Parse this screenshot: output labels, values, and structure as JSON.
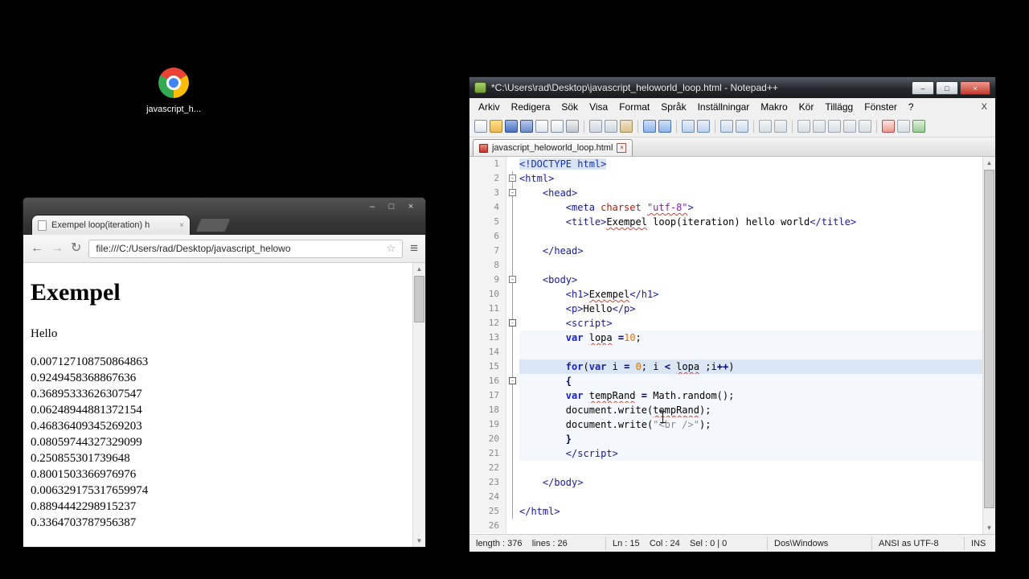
{
  "icons": {
    "minimize": "–",
    "maximize": "□",
    "close": "×",
    "back": "←",
    "forward": "→",
    "reload": "↻",
    "star": "☆",
    "menu": "≡",
    "up": "▲",
    "down": "▼",
    "fold_collapse": "-"
  },
  "desktop": {
    "icon_label": "javascript_h..."
  },
  "browser": {
    "tab_title": "Exempel loop(iteration) h",
    "url": "file:///C:/Users/rad/Desktop/javascript_helowo",
    "page": {
      "heading": "Exempel",
      "intro": "Hello",
      "numbers": [
        "0.007127108750864863",
        "0.9249458368867636",
        "0.36895333626307547",
        "0.06248944881372154",
        "0.46836409345269203",
        "0.08059744327329099",
        "0.250855301739648",
        "0.8001503366976976",
        "0.006329175317659974",
        "0.8894442298915237",
        "0.3364703787956387"
      ]
    }
  },
  "notepad": {
    "title": "*C:\\Users\\rad\\Desktop\\javascript_heloworld_loop.html - Notepad++",
    "menu": [
      "Arkiv",
      "Redigera",
      "Sök",
      "Visa",
      "Format",
      "Språk",
      "Inställningar",
      "Makro",
      "Kör",
      "Tillägg",
      "Fönster",
      "?"
    ],
    "menubar_close": "X",
    "toolbar_icons": [
      "new-file",
      "open",
      "save",
      "save-all",
      "close-doc",
      "close-all",
      "print",
      "|",
      "cut",
      "copy",
      "paste",
      "|",
      "undo",
      "redo",
      "|",
      "find",
      "replace",
      "|",
      "zoom-in",
      "zoom-out",
      "|",
      "sync-scroll-v",
      "sync-scroll-h",
      "|",
      "word-wrap",
      "show-all-chars",
      "indent-guide",
      "function-list",
      "doc-map",
      "|",
      "record-macro",
      "stop-macro",
      "play-macro"
    ],
    "tab": {
      "label": "javascript_heloworld_loop.html"
    },
    "editor": {
      "lines": [
        {
          "num": 1,
          "fold": "none",
          "band": false,
          "current": false,
          "segs": [
            [
              "doctype",
              "<!DOCTYPE html>"
            ]
          ]
        },
        {
          "num": 2,
          "fold": "box",
          "band": false,
          "current": false,
          "segs": [
            [
              "t",
              "<html>"
            ]
          ]
        },
        {
          "num": 3,
          "fold": "box",
          "band": false,
          "current": false,
          "segs": [
            [
              "pl",
              "    "
            ],
            [
              "t",
              "<head>"
            ]
          ]
        },
        {
          "num": 4,
          "fold": "line",
          "band": false,
          "current": false,
          "segs": [
            [
              "pl",
              "        "
            ],
            [
              "t",
              "<meta "
            ],
            [
              "attr",
              "charset "
            ],
            [
              "val",
              "\"utf-8\""
            ],
            [
              "t",
              ">"
            ]
          ]
        },
        {
          "num": 5,
          "fold": "line",
          "band": false,
          "current": false,
          "segs": [
            [
              "pl",
              "        "
            ],
            [
              "t",
              "<title>"
            ],
            [
              "sp",
              "Exempel"
            ],
            [
              "pl",
              " loop(iteration) hello world"
            ],
            [
              "t",
              "</title>"
            ]
          ]
        },
        {
          "num": 6,
          "fold": "line",
          "band": false,
          "current": false,
          "segs": []
        },
        {
          "num": 7,
          "fold": "line",
          "band": false,
          "current": false,
          "segs": [
            [
              "pl",
              "    "
            ],
            [
              "t",
              "</head>"
            ]
          ]
        },
        {
          "num": 8,
          "fold": "line",
          "band": false,
          "current": false,
          "segs": []
        },
        {
          "num": 9,
          "fold": "box",
          "band": false,
          "current": false,
          "segs": [
            [
              "pl",
              "    "
            ],
            [
              "t",
              "<body>"
            ]
          ]
        },
        {
          "num": 10,
          "fold": "line",
          "band": false,
          "current": false,
          "segs": [
            [
              "pl",
              "        "
            ],
            [
              "t",
              "<h1>"
            ],
            [
              "sp",
              "Exempel"
            ],
            [
              "t",
              "</h1>"
            ]
          ]
        },
        {
          "num": 11,
          "fold": "line",
          "band": false,
          "current": false,
          "segs": [
            [
              "pl",
              "        "
            ],
            [
              "t",
              "<p>"
            ],
            [
              "pl",
              "Hello"
            ],
            [
              "t",
              "</p>"
            ]
          ]
        },
        {
          "num": 12,
          "fold": "box-red",
          "band": false,
          "current": false,
          "segs": [
            [
              "pl",
              "        "
            ],
            [
              "t",
              "<script>"
            ]
          ]
        },
        {
          "num": 13,
          "fold": "line",
          "band": true,
          "current": false,
          "segs": [
            [
              "pl",
              "        "
            ],
            [
              "kw",
              "var"
            ],
            [
              "pl",
              " "
            ],
            [
              "sp",
              "lopa"
            ],
            [
              "pl",
              " "
            ],
            [
              "op",
              "="
            ],
            [
              "num",
              "10"
            ],
            [
              "pl",
              ";"
            ]
          ]
        },
        {
          "num": 14,
          "fold": "line",
          "band": true,
          "current": false,
          "segs": []
        },
        {
          "num": 15,
          "fold": "line",
          "band": true,
          "current": true,
          "segs": [
            [
              "pl",
              "        "
            ],
            [
              "kw",
              "for"
            ],
            [
              "pl",
              "("
            ],
            [
              "kw",
              "var"
            ],
            [
              "pl",
              " i "
            ],
            [
              "op",
              "="
            ],
            [
              "pl",
              " "
            ],
            [
              "num",
              "0"
            ],
            [
              "pl",
              "; i "
            ],
            [
              "op",
              "<"
            ],
            [
              "pl",
              " "
            ],
            [
              "sp",
              "lopa"
            ],
            [
              "pl",
              " ;i"
            ],
            [
              "op",
              "++"
            ],
            [
              "pl",
              ")"
            ]
          ]
        },
        {
          "num": 16,
          "fold": "box-red",
          "band": true,
          "current": false,
          "segs": [
            [
              "pl",
              "        "
            ],
            [
              "op",
              "{"
            ]
          ]
        },
        {
          "num": 17,
          "fold": "line",
          "band": true,
          "current": false,
          "segs": [
            [
              "pl",
              "        "
            ],
            [
              "kw",
              "var"
            ],
            [
              "pl",
              " "
            ],
            [
              "sp",
              "tempRand"
            ],
            [
              "pl",
              " "
            ],
            [
              "op",
              "="
            ],
            [
              "pl",
              " Math.random();"
            ]
          ]
        },
        {
          "num": 18,
          "fold": "line",
          "band": true,
          "current": false,
          "segs": [
            [
              "pl",
              "        document.write("
            ],
            [
              "sp",
              "tempRand"
            ],
            [
              "pl",
              ");"
            ]
          ]
        },
        {
          "num": 19,
          "fold": "line",
          "band": true,
          "current": false,
          "segs": [
            [
              "pl",
              "        document.write("
            ],
            [
              "str",
              "\"<br />\""
            ],
            [
              "pl",
              ");"
            ]
          ]
        },
        {
          "num": 20,
          "fold": "line",
          "band": true,
          "current": false,
          "segs": [
            [
              "pl",
              "        "
            ],
            [
              "op",
              "}"
            ]
          ]
        },
        {
          "num": 21,
          "fold": "line",
          "band": true,
          "current": false,
          "segs": [
            [
              "pl",
              "        "
            ],
            [
              "t",
              "</script>"
            ]
          ]
        },
        {
          "num": 22,
          "fold": "line",
          "band": false,
          "current": false,
          "segs": []
        },
        {
          "num": 23,
          "fold": "line",
          "band": false,
          "current": false,
          "segs": [
            [
              "pl",
              "    "
            ],
            [
              "t",
              "</body>"
            ]
          ]
        },
        {
          "num": 24,
          "fold": "line",
          "band": false,
          "current": false,
          "segs": []
        },
        {
          "num": 25,
          "fold": "line",
          "band": false,
          "current": false,
          "segs": [
            [
              "t",
              "</html>"
            ]
          ]
        },
        {
          "num": 26,
          "fold": "none",
          "band": false,
          "current": false,
          "segs": []
        }
      ]
    },
    "status": {
      "doc_info": "length : 376    lines : 26",
      "cursor_info": "Ln : 15    Col : 24    Sel : 0 | 0",
      "eol": "Dos\\Windows",
      "encoding": "ANSI as UTF-8",
      "mode": "INS"
    }
  }
}
